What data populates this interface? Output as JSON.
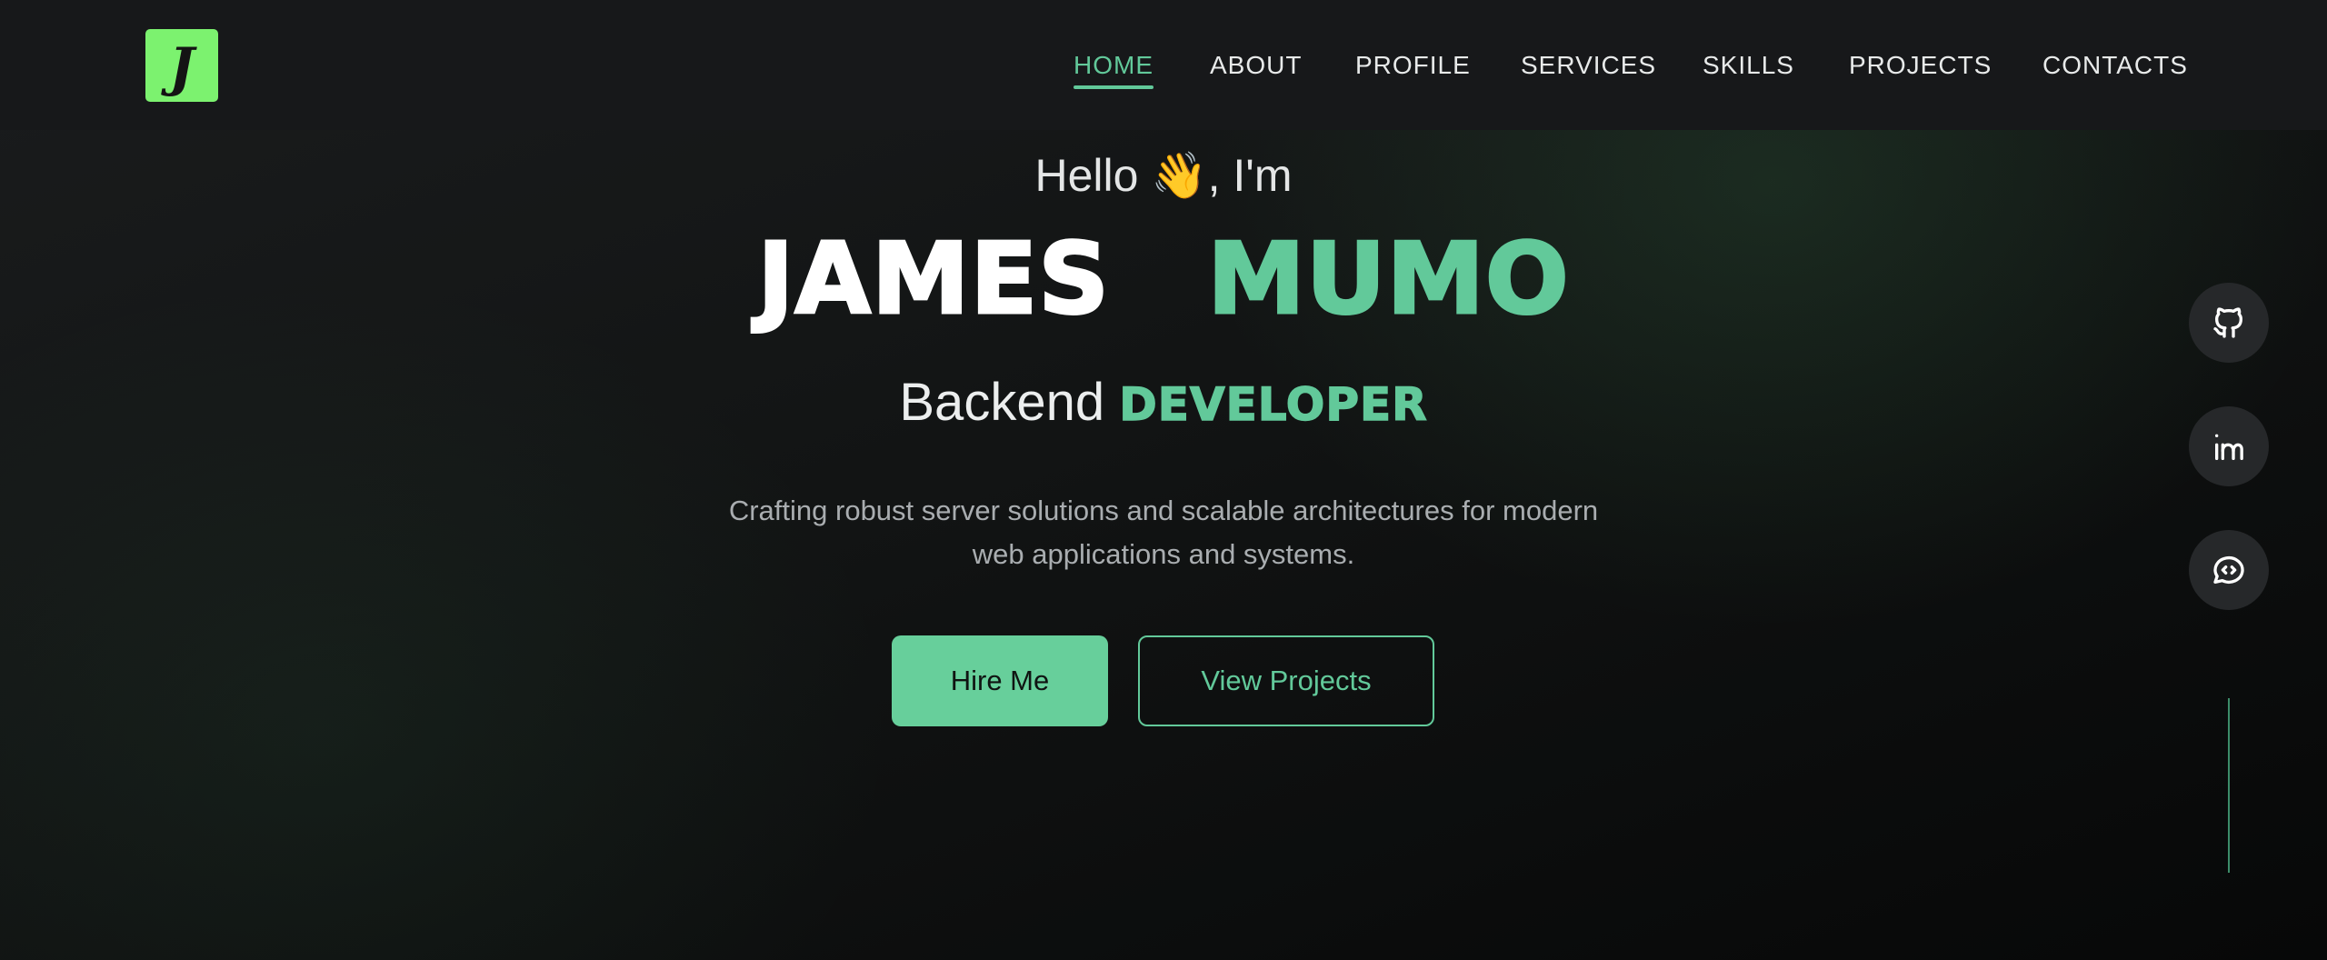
{
  "header": {
    "logo_letter": "J",
    "nav": [
      {
        "label": "HOME",
        "active": true
      },
      {
        "label": "ABOUT",
        "active": false
      },
      {
        "label": "PROFILE",
        "active": false
      },
      {
        "label": "SERVICES",
        "active": false
      },
      {
        "label": "SKILLS",
        "active": false
      },
      {
        "label": "PROJECTS",
        "active": false
      },
      {
        "label": "CONTACTS",
        "active": false
      }
    ]
  },
  "hero": {
    "greeting": "Hello 👋, I'm",
    "first_name": "JAMES",
    "last_name": "MUMO",
    "role_prefix": "Backend",
    "role_accent": "DEVELOPER",
    "description": "Crafting robust server solutions and scalable architectures for modern web applications and systems.",
    "hire_button": "Hire Me",
    "projects_button": "View Projects"
  },
  "social": {
    "icons": [
      "github-icon",
      "linkedin-icon",
      "chat-code-icon"
    ]
  },
  "colors": {
    "accent": "#62c99a",
    "logo_bg": "#7cf26f",
    "header_bg": "#17181a",
    "text": "#e8eaea"
  }
}
